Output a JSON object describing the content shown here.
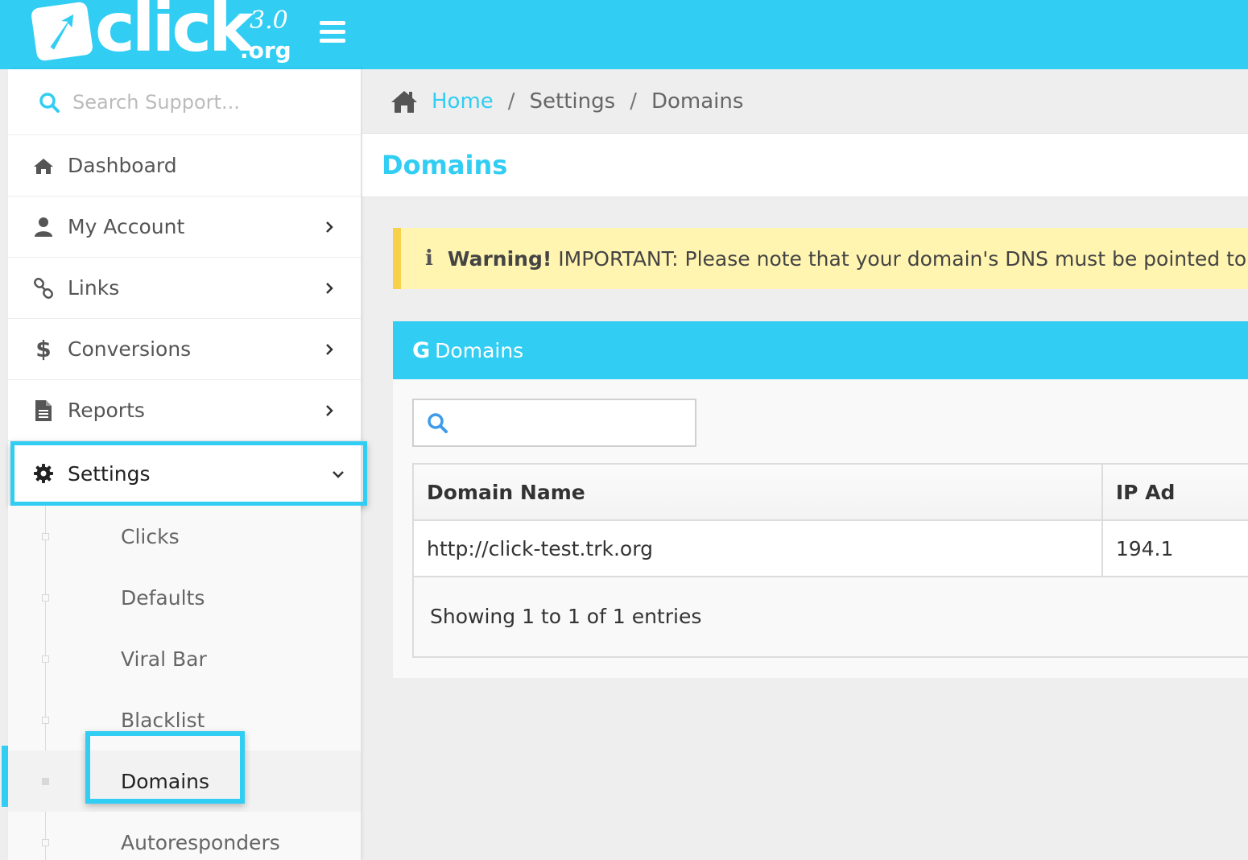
{
  "header": {
    "logo_word": "click",
    "logo_version": "3.0",
    "logo_tld": ".org",
    "brand_color": "#31cdf3",
    "menu_icon": "hamburger-icon"
  },
  "sidebar": {
    "search_placeholder": "Search Support...",
    "items": [
      {
        "label": "Dashboard",
        "icon": "home-icon"
      },
      {
        "label": "My Account",
        "icon": "user-icon"
      },
      {
        "label": "Links",
        "icon": "link-icon"
      },
      {
        "label": "Conversions",
        "icon": "dollar-icon"
      },
      {
        "label": "Reports",
        "icon": "document-icon"
      },
      {
        "label": "Settings",
        "icon": "gear-icon"
      }
    ],
    "submenu": [
      {
        "label": "Clicks"
      },
      {
        "label": "Defaults"
      },
      {
        "label": "Viral Bar"
      },
      {
        "label": "Blacklist"
      },
      {
        "label": "Domains"
      },
      {
        "label": "Autoresponders"
      }
    ]
  },
  "breadcrumb": {
    "home": "Home",
    "sep": "/",
    "level1": "Settings",
    "level2": "Domains"
  },
  "page": {
    "title": "Domains"
  },
  "alert": {
    "icon": "i",
    "strong": "Warning!",
    "text": "IMPORTANT: Please note that your domain's DNS must be pointed to ap",
    "bg_color": "#fff4b0",
    "border_color": "#f7d04c"
  },
  "panel": {
    "icon_letter": "G",
    "title": "Domains",
    "search_value": "",
    "columns": [
      "Domain Name",
      "IP Ad"
    ],
    "rows": [
      {
        "domain": "http://click-test.trk.org",
        "ip": "194.1"
      }
    ],
    "info": "Showing 1 to 1 of 1 entries"
  }
}
